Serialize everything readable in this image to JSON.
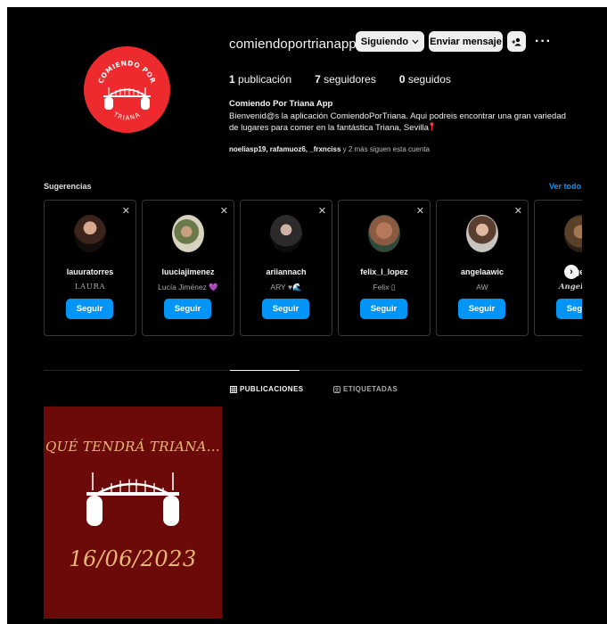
{
  "profile": {
    "username": "comiendoportrianapp",
    "logo_text_top": "COMIENDO POR",
    "logo_text_bottom": "TRIANA",
    "buttons": {
      "following": "Siguiendo",
      "message": "Enviar mensaje"
    },
    "stats": {
      "posts_count": "1",
      "posts_label": "publicación",
      "followers_count": "7",
      "followers_label": "seguidores",
      "following_count": "0",
      "following_label": "seguidos"
    },
    "full_name": "Comiendo Por Triana App",
    "bio": "Bienvenid@s la aplicación ComiendoPorTriana. Aqui podreis encontrar una gran variedad de lugares para comer en la fantástica Triana, Sevilla",
    "followed_by_names": "noeliasp19, rafamuoz6, _frxnciss",
    "followed_by_rest": " y 2 más siguen esta cuenta"
  },
  "suggestions": {
    "title": "Sugerencias",
    "see_all": "Ver todo",
    "follow_label": "Seguir",
    "items": [
      {
        "username": "lauuratorres",
        "name": "LAURA"
      },
      {
        "username": "luuciajimenez",
        "name": "Lucía Jiménez 💜"
      },
      {
        "username": "ariiannach",
        "name": "ARY ♥🌊"
      },
      {
        "username": "felix_l_lopez",
        "name": "Felix ▯"
      },
      {
        "username": "angelaawic",
        "name": "AW"
      },
      {
        "username": "angelaa",
        "name": "Angela Ca"
      }
    ]
  },
  "tabs": {
    "posts": "PUBLICACIONES",
    "tagged": "ETIQUETADAS"
  },
  "post": {
    "title": "QUÉ TENDRÁ TRIANA...",
    "date": "16/06/2023"
  },
  "colors": {
    "accent": "#0095f6",
    "logo_bg": "#ed2b2e",
    "post_bg": "#6b0a09",
    "post_text": "#e8b777"
  }
}
